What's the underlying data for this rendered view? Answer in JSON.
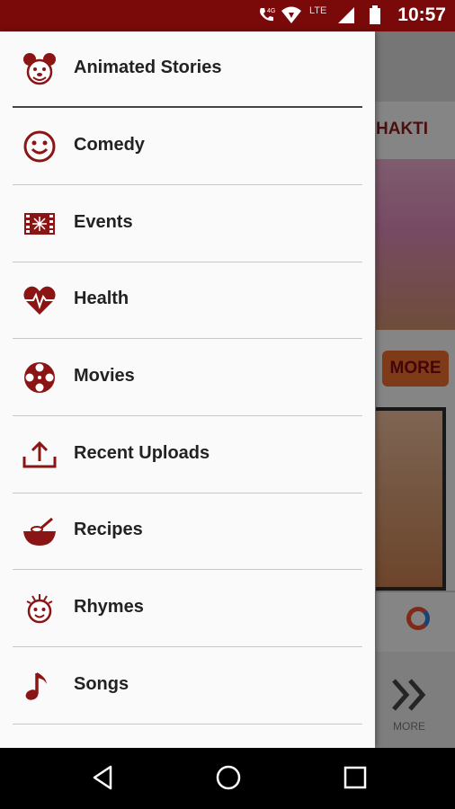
{
  "status_bar": {
    "time": "10:57",
    "network_label": "LTE",
    "icons": [
      "wifi-calling-icon",
      "wifi-icon",
      "signal-icon",
      "battery-icon"
    ]
  },
  "background": {
    "section_title": "HAKTI",
    "more_button": "MORE",
    "more_nav_label": "MORE"
  },
  "drawer": {
    "items": [
      {
        "label": "Animated Stories",
        "icon": "mouse-face-icon"
      },
      {
        "label": "Comedy",
        "icon": "smiley-icon"
      },
      {
        "label": "Events",
        "icon": "events-icon"
      },
      {
        "label": "Health",
        "icon": "heart-pulse-icon"
      },
      {
        "label": "Movies",
        "icon": "film-reel-icon"
      },
      {
        "label": "Recent Uploads",
        "icon": "upload-icon"
      },
      {
        "label": "Recipes",
        "icon": "mixing-bowl-icon"
      },
      {
        "label": "Rhymes",
        "icon": "child-face-icon"
      },
      {
        "label": "Songs",
        "icon": "music-note-icon"
      }
    ]
  },
  "colors": {
    "accent": "#7a0a0a",
    "icon": "#8b1414"
  }
}
